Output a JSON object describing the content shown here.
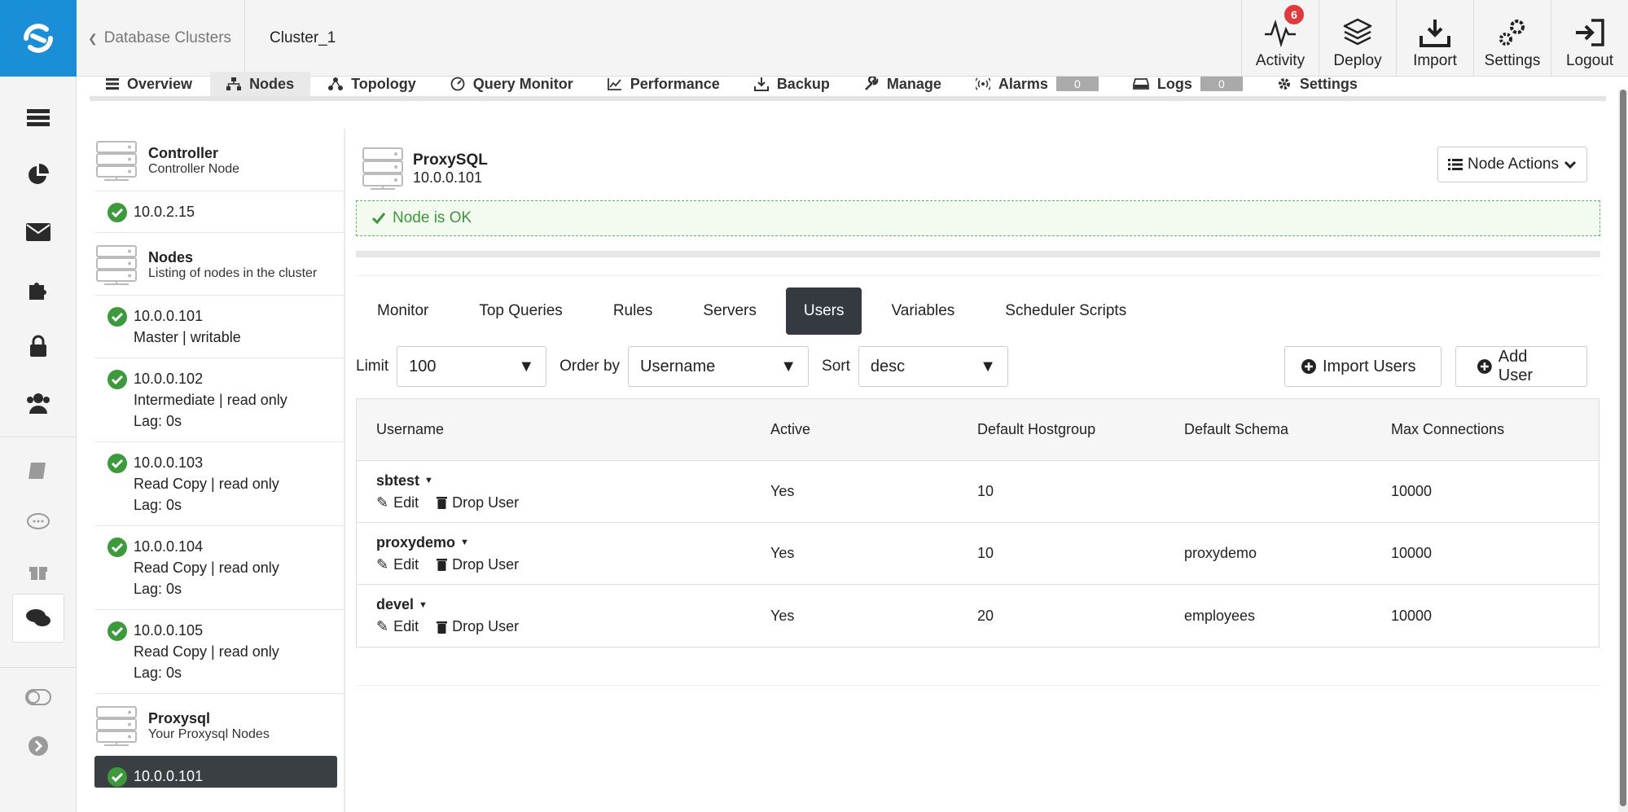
{
  "topbar": {
    "breadcrumb": "Database Clusters",
    "cluster": "Cluster_1",
    "actions": [
      {
        "label": "Activity",
        "badge": "6"
      },
      {
        "label": "Deploy"
      },
      {
        "label": "Import"
      },
      {
        "label": "Settings"
      },
      {
        "label": "Logout"
      }
    ]
  },
  "tabs": [
    {
      "label": "Overview"
    },
    {
      "label": "Nodes"
    },
    {
      "label": "Topology"
    },
    {
      "label": "Query Monitor"
    },
    {
      "label": "Performance"
    },
    {
      "label": "Backup"
    },
    {
      "label": "Manage"
    },
    {
      "label": "Alarms",
      "count": "0"
    },
    {
      "label": "Logs",
      "count": "0"
    },
    {
      "label": "Settings"
    }
  ],
  "sidebar": {
    "controller": {
      "title": "Controller",
      "subtitle": "Controller Node",
      "node": "10.0.2.15"
    },
    "nodes_group": {
      "title": "Nodes",
      "subtitle": "Listing of nodes in the cluster"
    },
    "nodes": [
      {
        "ip": "10.0.0.101",
        "role": "Master | writable",
        "lag": ""
      },
      {
        "ip": "10.0.0.102",
        "role": "Intermediate | read only",
        "lag": "Lag: 0s"
      },
      {
        "ip": "10.0.0.103",
        "role": "Read Copy | read only",
        "lag": "Lag: 0s"
      },
      {
        "ip": "10.0.0.104",
        "role": "Read Copy | read only",
        "lag": "Lag: 0s"
      },
      {
        "ip": "10.0.0.105",
        "role": "Read Copy | read only",
        "lag": "Lag: 0s"
      }
    ],
    "proxysql_group": {
      "title": "Proxysql",
      "subtitle": "Your Proxysql Nodes",
      "node": "10.0.0.101"
    }
  },
  "panel": {
    "title": "ProxySQL",
    "ip": "10.0.0.101",
    "node_actions": "Node Actions",
    "status": "Node is OK",
    "subtabs": [
      "Monitor",
      "Top Queries",
      "Rules",
      "Servers",
      "Users",
      "Variables",
      "Scheduler Scripts"
    ],
    "filters": {
      "limit_label": "Limit",
      "limit_value": "100",
      "order_label": "Order by",
      "order_value": "Username",
      "sort_label": "Sort",
      "sort_value": "desc"
    },
    "import_users": "Import Users",
    "add_user": "Add User",
    "columns": [
      "Username",
      "Active",
      "Default Hostgroup",
      "Default Schema",
      "Max Connections"
    ],
    "edit_label": "Edit",
    "drop_label": "Drop User",
    "rows": [
      {
        "username": "sbtest",
        "active": "Yes",
        "hostgroup": "10",
        "schema": "",
        "max": "10000"
      },
      {
        "username": "proxydemo",
        "active": "Yes",
        "hostgroup": "10",
        "schema": "proxydemo",
        "max": "10000"
      },
      {
        "username": "devel",
        "active": "Yes",
        "hostgroup": "20",
        "schema": "employees",
        "max": "10000"
      }
    ]
  },
  "colors": {
    "brand": "#1a8fd8",
    "ok": "#3c963c",
    "badge": "#e0393e",
    "active_tab": "#343a40"
  }
}
